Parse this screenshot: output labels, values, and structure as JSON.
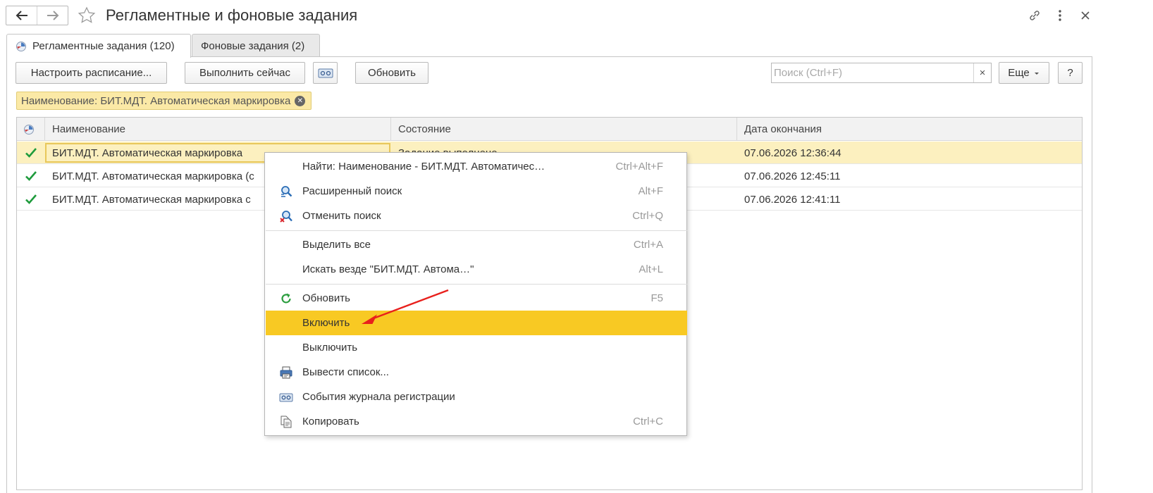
{
  "window": {
    "title": "Регламентные и фоновые задания"
  },
  "tabs": [
    {
      "label": "Регламентные задания (120)"
    },
    {
      "label": "Фоновые задания (2)"
    }
  ],
  "toolbar": {
    "schedule_label": "Настроить расписание...",
    "run_now_label": "Выполнить сейчас",
    "refresh_label": "Обновить",
    "more_label": "Еще",
    "help_label": "?"
  },
  "search": {
    "placeholder": "Поиск (Ctrl+F)",
    "value": "",
    "clear_label": "×"
  },
  "filter": {
    "label": "Наименование: БИТ.МДТ. Автоматическая маркировка"
  },
  "table": {
    "columns": [
      "Наименование",
      "Состояние",
      "Дата окончания"
    ],
    "rows": [
      {
        "name": "БИТ.МДТ. Автоматическая маркировка",
        "state": "Задание выполнено",
        "end": "07.06.2026 12:36:44"
      },
      {
        "name": "БИТ.МДТ. Автоматическая маркировка (с",
        "state": "",
        "end": "07.06.2026 12:45:11"
      },
      {
        "name": "БИТ.МДТ. Автоматическая маркировка с",
        "state": "",
        "end": "07.06.2026 12:41:11"
      }
    ]
  },
  "context_menu": {
    "items": [
      {
        "label": "Найти: Наименование - БИТ.МДТ. Автоматичес…",
        "shortcut": "Ctrl+Alt+F",
        "icon": "none"
      },
      {
        "label": "Расширенный поиск",
        "shortcut": "Alt+F",
        "icon": "advanced-search-icon"
      },
      {
        "label": "Отменить поиск",
        "shortcut": "Ctrl+Q",
        "icon": "cancel-search-icon"
      },
      {
        "label": "Выделить все",
        "shortcut": "Ctrl+A",
        "icon": "none"
      },
      {
        "label": "Искать везде \"БИТ.МДТ. Автома…\"",
        "shortcut": "Alt+L",
        "icon": "none"
      },
      {
        "label": "Обновить",
        "shortcut": "F5",
        "icon": "refresh-icon"
      },
      {
        "label": "Включить",
        "shortcut": "",
        "icon": "none"
      },
      {
        "label": "Выключить",
        "shortcut": "",
        "icon": "none"
      },
      {
        "label": "Вывести список...",
        "shortcut": "",
        "icon": "print-list-icon"
      },
      {
        "label": "События журнала регистрации",
        "shortcut": "",
        "icon": "event-log-icon"
      },
      {
        "label": "Копировать",
        "shortcut": "Ctrl+C",
        "icon": "copy-icon"
      }
    ]
  },
  "colors": {
    "highlight": "#f8c923",
    "selected_row": "#fcf0bf",
    "check_green": "#1e9b3c",
    "arrow_red": "#e8201c"
  }
}
